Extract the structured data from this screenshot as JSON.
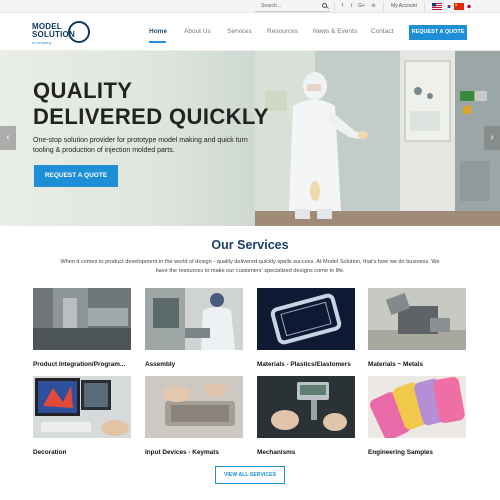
{
  "topbar": {
    "search_placeholder": "Search...",
    "social": [
      "f",
      "t",
      "G+",
      "in"
    ],
    "account_label": "My Account"
  },
  "logo": {
    "line1": "MODEL",
    "line2": "SOLUTION",
    "tagline": "a company"
  },
  "nav": {
    "items": [
      "Home",
      "About Us",
      "Services",
      "Resources",
      "News & Events",
      "Contact"
    ],
    "active": "Home",
    "cta_label": "REQUEST A QUOTE"
  },
  "hero": {
    "title_line1": "QUALITY",
    "title_line2": "DELIVERED QUICKLY",
    "subtitle": "One-stop solution provider for prototype model making and quick turn tooling & production of injection molded parts.",
    "button_label": "REQUEST A QUOTE",
    "prev_arrow": "‹",
    "next_arrow": "›"
  },
  "services": {
    "title": "Our Services",
    "intro": "When it comes to product development in the world of design - quality delivered quickly spells success. At Model Solution, that's how we do business. We have the resources to make our customers' specialized designs come to life.",
    "items": [
      {
        "label": "Product Integration/Program..."
      },
      {
        "label": "Assembly"
      },
      {
        "label": "Materials - Plastics/Elastomers"
      },
      {
        "label": "Materials ~ Metals"
      },
      {
        "label": "Decoration"
      },
      {
        "label": "Input Devices - Keymats"
      },
      {
        "label": "Mechanisms"
      },
      {
        "label": "Engineering Samples"
      }
    ],
    "view_all_label": "VIEW ALL SERVICES"
  },
  "colors": {
    "accent": "#1e8fd6",
    "brand_navy": "#1b3e66"
  }
}
